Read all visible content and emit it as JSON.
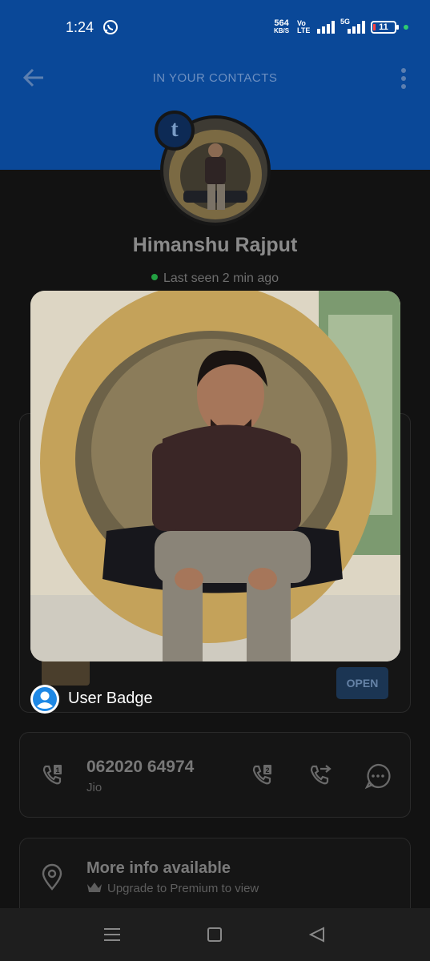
{
  "status_bar": {
    "time": "1:24",
    "net_speed_value": "564",
    "net_speed_unit": "KB/S",
    "volte_top": "Vo",
    "volte_bottom": "LTE",
    "network_type": "5G",
    "battery_level": "11"
  },
  "app_bar": {
    "title": "IN YOUR CONTACTS",
    "back_icon": "arrow-left-icon",
    "menu_icon": "more-vert-icon"
  },
  "profile": {
    "name": "Himanshu Rajput",
    "last_seen": "Last seen 2 min ago",
    "source_badge": "t",
    "online_color": "#23a042"
  },
  "ad": {
    "open_label": "OPEN"
  },
  "phone": {
    "number": "062020 64974",
    "carrier": "Jio",
    "sim_label": "1",
    "sim2_label": "2"
  },
  "more_info": {
    "title": "More info available",
    "subtitle": "Upgrade to Premium to view"
  },
  "popup": {
    "badge_label": "User Badge"
  },
  "colors": {
    "header_blue": "#0a4898",
    "background": "#121212",
    "accent": "#1b3553"
  }
}
